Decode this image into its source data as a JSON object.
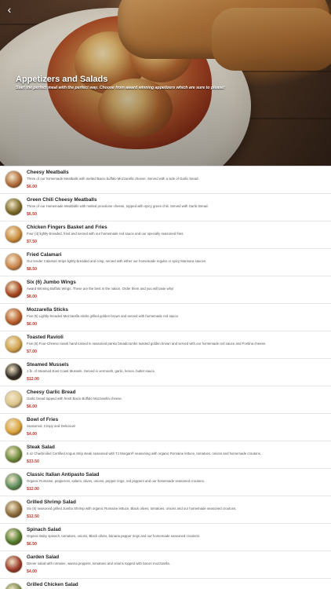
{
  "header": {
    "back_icon": "chevron-left-icon",
    "title": "Appetizers and Salads",
    "subtitle": "Start the perfect meal with the perfect way. Choose from award winning appetizers which are sure to please!"
  },
  "colors": {
    "price": "#c0392b",
    "title": "#ffffff"
  },
  "items": [
    {
      "name": "Cheesy Meatballs",
      "description": "Three of our homemade Meatballs with melted Bacio buffalo Mozzarella cheese. Served with a side of Garlic bread.",
      "price": "$6.00",
      "thumb_color": "#b06a3a"
    },
    {
      "name": "Green Chili Cheesy Meatballs",
      "description": "Three of our Homemade Meatballs with melted provolone cheese, topped with spicy green chili. Served with Garlic Bread.",
      "price": "$6.50",
      "thumb_color": "#7a6a2a"
    },
    {
      "name": "Chicken Fingers Basket and Fries",
      "description": "Four (4) lightly-breaded, fried and served with our homemade red sauce and our specially seasoned fries.",
      "price": "$7.50",
      "thumb_color": "#c98a3a"
    },
    {
      "name": "Fried Calamari",
      "description": "Our tender Calamari strips lightly-breaded and crisp, served with either our homemade regular or spicy Marinara sauces.",
      "price": "$8.50",
      "thumb_color": "#c7834a"
    },
    {
      "name": "Six (6) Jumbo Wings",
      "description": "Award Winning Buffalo Wings. These are the best in the nation. Order them and you will taste why!",
      "price": "$8.00",
      "thumb_color": "#a6451f"
    },
    {
      "name": "Mozzarella Sticks",
      "description": "Five (5) Lightly-breaded Mozzarella sticks grilled golden brown and served with homemade red sauce.",
      "price": "$6.00",
      "thumb_color": "#b85c2a"
    },
    {
      "name": "Toasted Ravioli",
      "description": "Five (5) Four-Cheese ravioli hand tossed in seasoned panko breadcrumbs toasted golden brown and served with our homemade red sauce and Fontina cheese.",
      "price": "$7.00",
      "thumb_color": "#cfa14a"
    },
    {
      "name": "Steamed Mussels",
      "description": "1 lb. of Steamed East Coast Mussels. Served in vermouth, garlic, lemon, butter sauce.",
      "price": "$12.00",
      "thumb_color": "#2e2a22"
    },
    {
      "name": "Cheesy Garlic Bread",
      "description": "Garlic bread topped with fresh Bacio Buffalo Mozzarella cheese.",
      "price": "$6.00",
      "thumb_color": "#d9c48a"
    },
    {
      "name": "Bowl of Fries",
      "description": "Seasoned, Crispy and Delicious!",
      "price": "$4.00",
      "thumb_color": "#d9a23a"
    },
    {
      "name": "Steak Salad",
      "description": "6 oz Charbroiled Certified Angus Strip steak seasoned with TJ Morgan® seasoning with organic Romaine lettuce, tomatoes, onions and homemade croutons.",
      "price": "$13.50",
      "thumb_color": "#6a8a3a"
    },
    {
      "name": "Classic Italian Antipasto Salad",
      "description": "Organic Romaine, pepperoni, salami, olives, onions, pepper rings, red peppers and our homemade seasoned croutons.",
      "price": "$12.00",
      "thumb_color": "#5a8a5a"
    },
    {
      "name": "Grilled Shrimp Salad",
      "description": "Six (6) seasoned grilled Jumbo Shrimp with organic Romaine lettuce, Black olives, tomatoes, onions and our homemade seasoned croutons.",
      "price": "$12.50",
      "thumb_color": "#8a6a3a"
    },
    {
      "name": "Spinach Salad",
      "description": "Organic Baby spinach, tomatoes, onions, Black olives, banana pepper rings and our homemade seasoned croutons.",
      "price": "$6.50",
      "thumb_color": "#4f7a2a"
    },
    {
      "name": "Garden Salad",
      "description": "Dinner salad with romaine, wanna peppers, tomatoes and onions topped with bacon mozzarella.",
      "price": "$4.00",
      "thumb_color": "#9a3a2a"
    },
    {
      "name": "Grilled Chicken Salad",
      "description": "",
      "price": "",
      "thumb_color": "#7a8a4a"
    }
  ]
}
